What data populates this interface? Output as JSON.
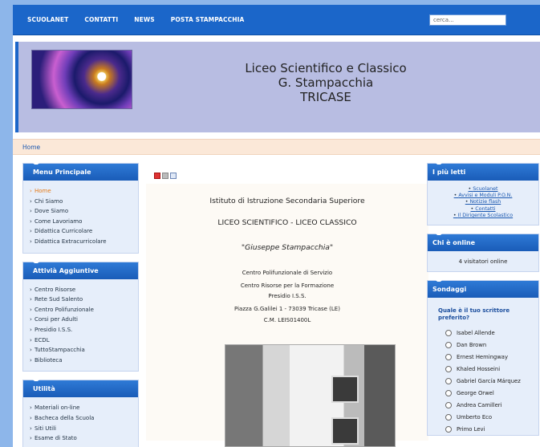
{
  "topnav": {
    "links": [
      "SCUOLANET",
      "CONTATTI",
      "NEWS",
      "POSTA STAMPACCHIA"
    ],
    "search_placeholder": "cerca..."
  },
  "header": {
    "title_line1": "Liceo Scientifico e Classico",
    "title_line2": "G. Stampacchia",
    "title_line3": "TRICASE"
  },
  "breadcrumb": {
    "home": "Home"
  },
  "left": {
    "menu_principale": {
      "title": "Menu Principale",
      "items": [
        "Home",
        "Chi Siamo",
        "Dove Siamo",
        "Come Lavoriamo",
        "Didattica Curricolare",
        "Didattica Extracurricolare"
      ]
    },
    "attivita": {
      "title": "Attivià Aggiuntive",
      "items": [
        "Centro Risorse",
        "Rete Sud Salento",
        "Centro Polifunzionale",
        "Corsi per Adulti",
        "Presidio I.S.S.",
        "ECDL",
        "TuttoStampacchia",
        "Biblioteca"
      ]
    },
    "utilita": {
      "title": "Utilità",
      "items": [
        "Materiali on-line",
        "Bacheca della Scuola",
        "Siti Utili",
        "Esame di Stato"
      ]
    }
  },
  "main": {
    "istituto": "Istituto di Istruzione Secondaria Superiore",
    "liceo": "LICEO SCIENTIFICO - LICEO CLASSICO",
    "nome": "\"Giuseppe Stampacchia\"",
    "centro1": "Centro Polifunzionale di Servizio",
    "centro2": "Centro Risorse per la Formazione",
    "presidio": "Presidio I.S.S.",
    "indirizzo": "Piazza G.Galilei 1 - 73039 Tricase (LE)",
    "cm": "C.M. LEIS01400L",
    "icons": [
      "pdf-icon",
      "print-icon",
      "email-icon"
    ]
  },
  "right": {
    "piu_letti": {
      "title": "I più letti",
      "items": [
        "Scuolanet",
        "Avvisi e Moduli P.O.N.",
        "Notizie flash",
        "Contatti",
        "Il Dirigente Scolastico"
      ]
    },
    "online": {
      "title": "Chi è online",
      "text": "4 visitatori online"
    },
    "sondaggi": {
      "title": "Sondaggi",
      "question": "Quale è il tuo scrittore preferito?",
      "options": [
        "Isabel Allende",
        "Dan Brown",
        "Ernest Hemingway",
        "Khaled Hosseini",
        "Gabriel García Márquez",
        "George Orwel",
        "Andrea Camilleri",
        "Umberto Eco",
        "Primo Levi"
      ]
    }
  }
}
